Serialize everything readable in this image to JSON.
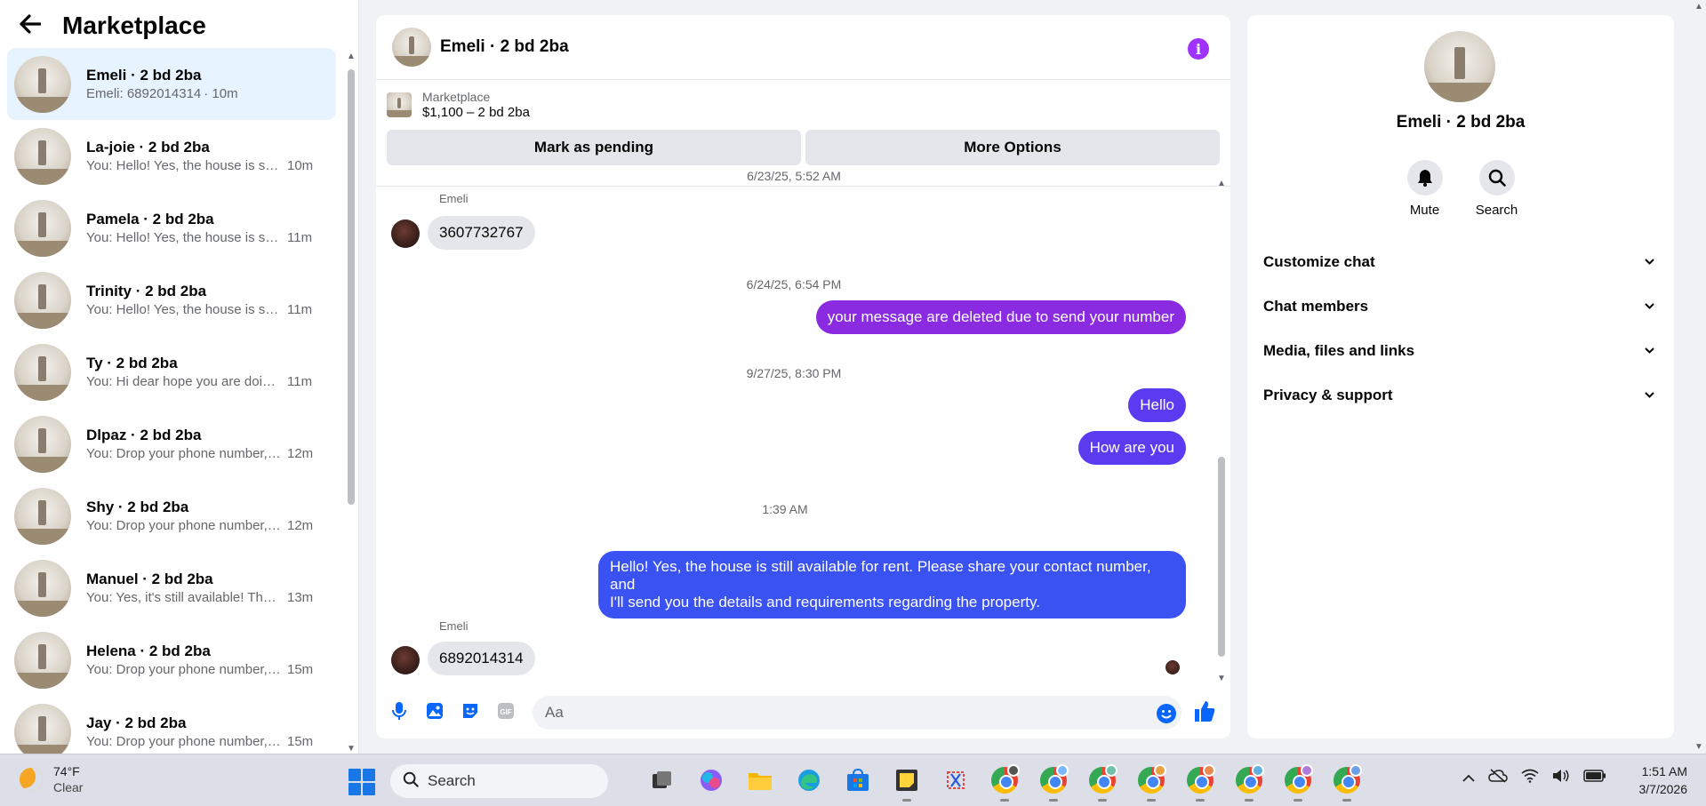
{
  "sidebar": {
    "title": "Marketplace",
    "conversations": [
      {
        "name": "Emeli · 2 bd 2ba",
        "snippet": "Emeli: 6892014314",
        "time": "· 10m",
        "active": true
      },
      {
        "name": "La-joie · 2 bd 2ba",
        "snippet": "You: Hello! Yes, the house is still a...",
        "time": "10m"
      },
      {
        "name": "Pamela · 2 bd 2ba",
        "snippet": "You: Hello! Yes, the house is still a...",
        "time": "11m"
      },
      {
        "name": "Trinity · 2 bd 2ba",
        "snippet": "You: Hello! Yes, the house is still a...",
        "time": "11m"
      },
      {
        "name": "Ty · 2 bd 2ba",
        "snippet": "You: Hi dear hope you are doing ...",
        "time": "11m"
      },
      {
        "name": "Dlpaz · 2 bd 2ba",
        "snippet": "You: Drop your phone number, a...",
        "time": "12m"
      },
      {
        "name": "Shy · 2 bd 2ba",
        "snippet": "You: Drop your phone number, a...",
        "time": "12m"
      },
      {
        "name": "Manuel · 2 bd 2ba",
        "snippet": "You: Yes, it's still available! Thank ...",
        "time": "13m"
      },
      {
        "name": "Helena · 2 bd 2ba",
        "snippet": "You: Drop your phone number, a...",
        "time": "15m"
      },
      {
        "name": "Jay · 2 bd 2ba",
        "snippet": "You: Drop your phone number, a...",
        "time": "15m"
      }
    ]
  },
  "chat": {
    "title": "Emeli · 2 bd 2ba",
    "listing": {
      "label": "Marketplace",
      "price": "$1,100 – 2 bd 2ba"
    },
    "buttons": {
      "pending": "Mark as pending",
      "more": "More Options"
    },
    "timestamps": [
      "6/23/25, 5:52 AM",
      "6/24/25, 6:54 PM",
      "9/27/25, 8:30 PM",
      "1:39 AM"
    ],
    "sender": "Emeli",
    "messages": {
      "in1": "3607732767",
      "out1": "your message are deleted  due to send your number",
      "out2": "Hello",
      "out3": "How are you",
      "out4a": "Hello! Yes, the house is still available for rent. Please share your contact number, and",
      "out4b": "I'll send you the details and requirements regarding the property.",
      "in2": "6892014314"
    },
    "composer_placeholder": "Aa",
    "colors": {
      "accent": "#0866ff",
      "info": "#a033ff",
      "bubble_purple": "#8a2be2",
      "bubble_violet": "#5a3bf0",
      "bubble_blue": "#3a52f2"
    }
  },
  "info_panel": {
    "name": "Emeli · 2 bd 2ba",
    "actions": {
      "mute": "Mute",
      "search": "Search"
    },
    "sections": [
      "Customize chat",
      "Chat members",
      "Media, files and links",
      "Privacy & support"
    ]
  },
  "taskbar": {
    "weather": {
      "temp": "74°F",
      "condition": "Clear"
    },
    "search_label": "Search",
    "clock": {
      "time": "1:51 AM",
      "date": "3/7/2026"
    }
  }
}
